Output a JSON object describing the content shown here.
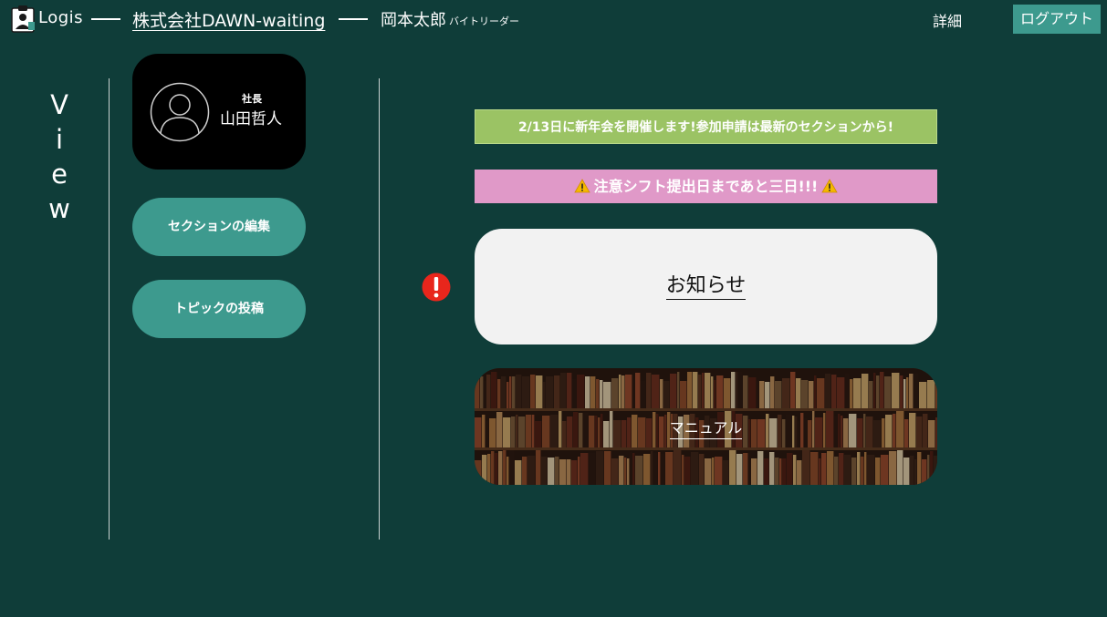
{
  "header": {
    "app_name": "Logis",
    "company": "株式会社DAWN-waiting",
    "user_name": "岡本太郎",
    "user_role": "バイトリーダー",
    "detail": "詳細",
    "logout": "ログアウト",
    "logo_icon": "clipboard-person-icon"
  },
  "sidebar": {
    "view_letters": [
      "V",
      "i",
      "e",
      "w"
    ],
    "profile": {
      "title": "社長",
      "name": "山田哲人",
      "avatar_icon": "user-avatar-icon"
    },
    "buttons": [
      {
        "label": "セクションの編集"
      },
      {
        "label": "トピックの投稿"
      }
    ]
  },
  "main": {
    "announcement": "2/13日に新年会を開催します!参加申請は最新のセクションから!",
    "warning": "注意シフト提出日まであと三日!!!",
    "warning_icon": "warning-triangle-icon",
    "alert_icon": "exclamation-alert-icon",
    "notice_label": "お知らせ",
    "manual_label": "マニュアル"
  },
  "colors": {
    "background": "#0f3d39",
    "accent": "#3d9a8e",
    "announcement": "#9bc364",
    "warning": "#e099c8",
    "notice_card": "#f2f2f2",
    "alert": "#e8261c"
  }
}
